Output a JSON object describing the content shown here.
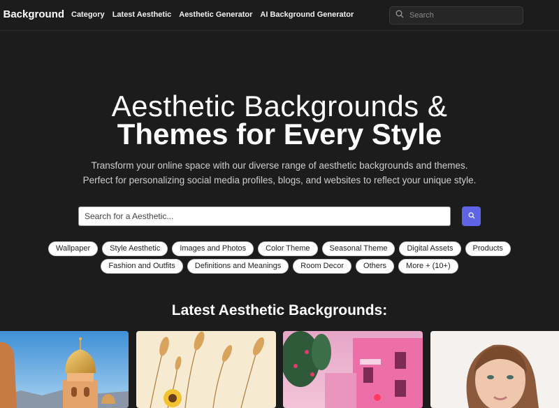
{
  "header": {
    "brand": "c Background",
    "nav": [
      "Category",
      "Latest Aesthetic",
      "Aesthetic Generator",
      "AI Background Generator"
    ],
    "search_placeholder": "Search",
    "search_icon": "search-icon"
  },
  "hero": {
    "title_line1": "Aesthetic Backgrounds &",
    "title_line2": "Themes for Every Style",
    "subtitle": "Transform your online space with our diverse range of aesthetic backgrounds and themes. Perfect for personalizing social media profiles, blogs, and websites to reflect your unique style.",
    "search_placeholder": "Search for a Aesthetic...",
    "search_button_icon": "search-icon",
    "accent_color": "#5f63e6"
  },
  "categories": {
    "row1": [
      "Wallpaper",
      "Style Aesthetic",
      "Images and Photos",
      "Color Theme",
      "Seasonal Theme",
      "Digital Assets",
      "Products"
    ],
    "row2": [
      "Fashion and Outfits",
      "Definitions and Meanings",
      "Room Decor",
      "Others",
      "More + (10+)"
    ]
  },
  "latest": {
    "title": "Latest Aesthetic Backgrounds:"
  }
}
